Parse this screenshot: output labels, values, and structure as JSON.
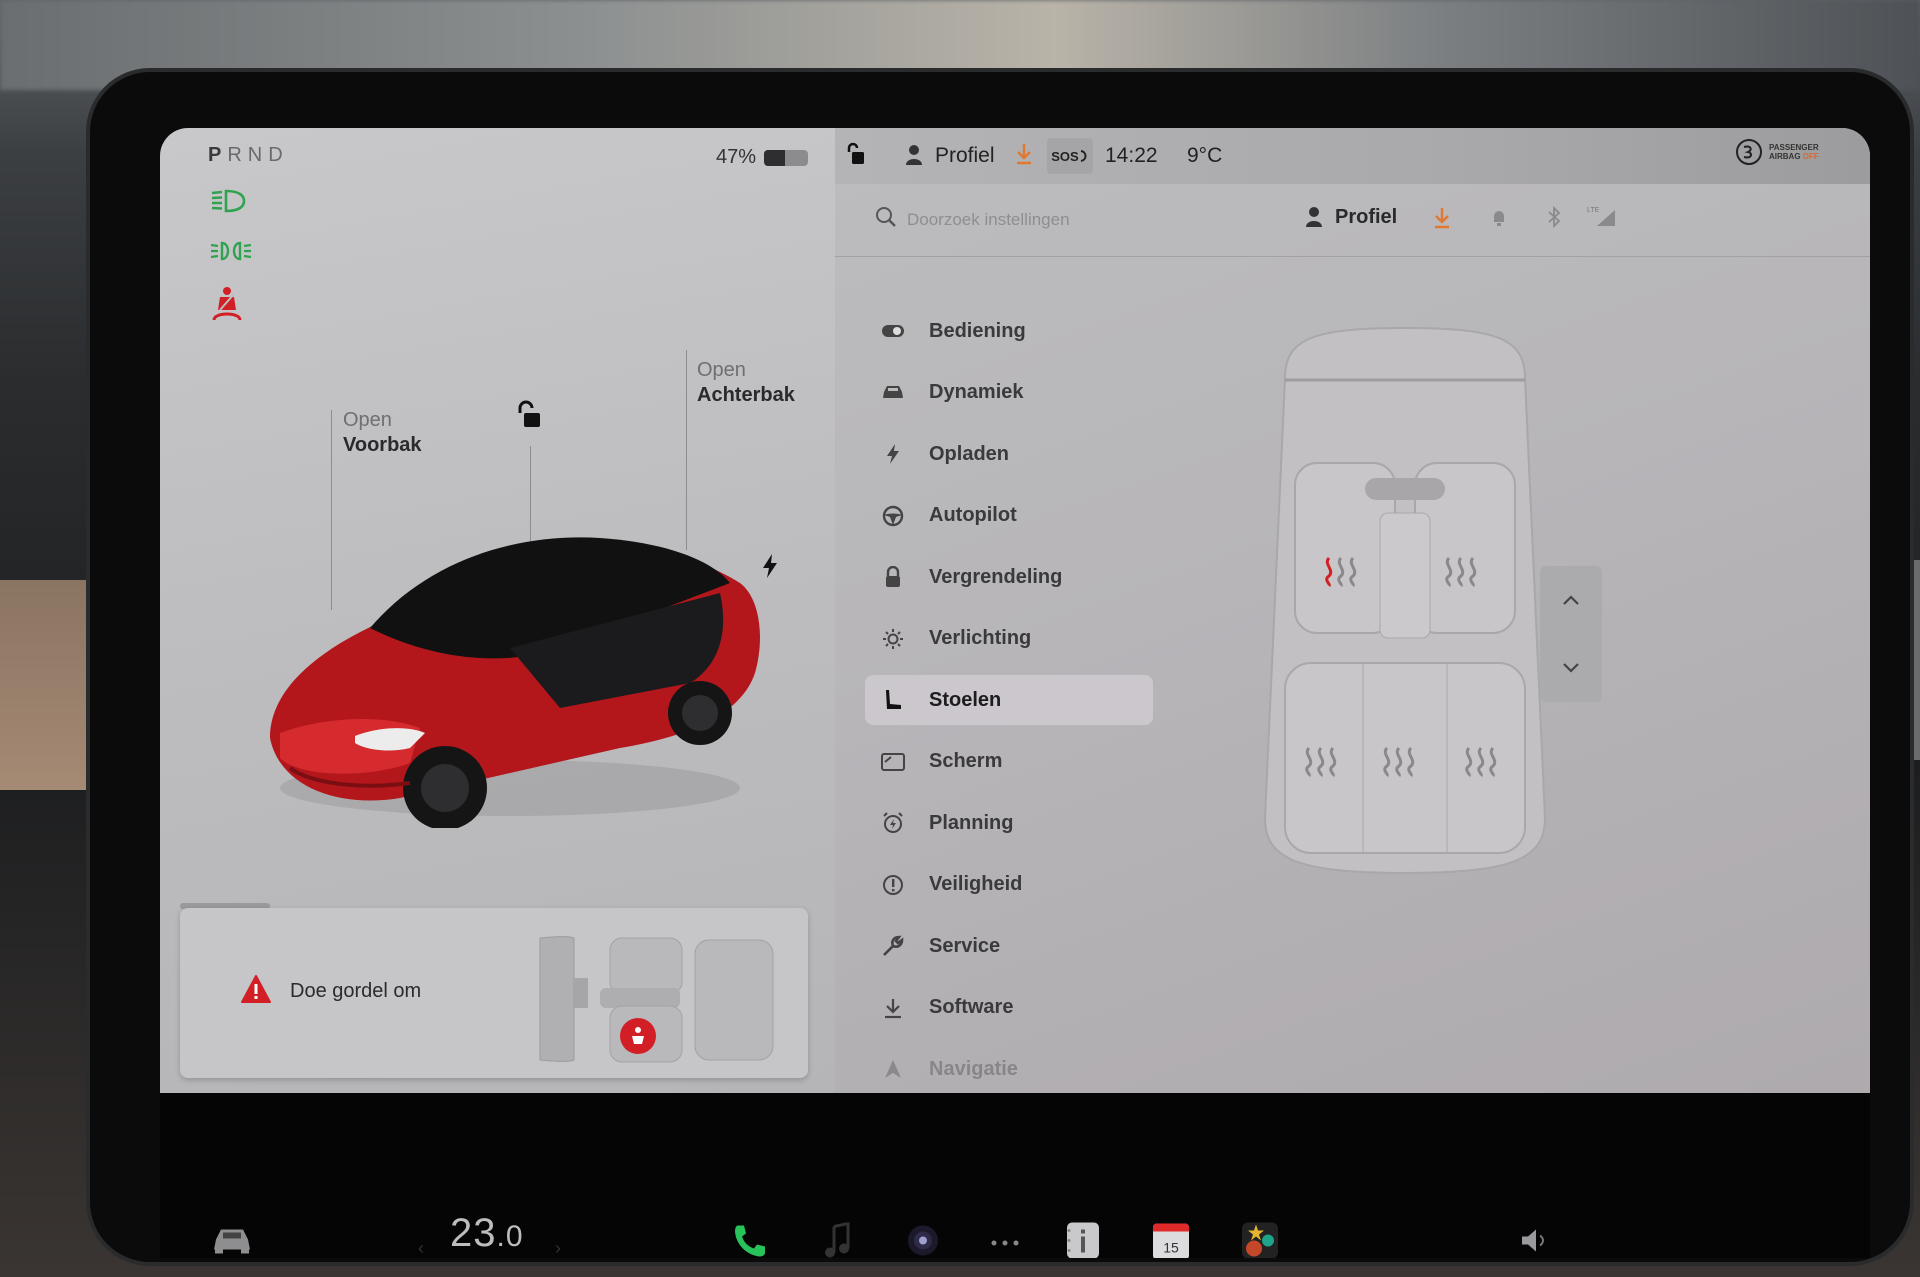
{
  "left_panel": {
    "gear": {
      "letters": [
        "P",
        "R",
        "N",
        "D"
      ],
      "active": "P"
    },
    "battery": {
      "percent_label": "47%",
      "level": 0.47
    },
    "frunk": {
      "action": "Open",
      "label": "Voorbak"
    },
    "trunk": {
      "action": "Open",
      "label": "Achterbak"
    },
    "indicators": [
      "low-beam-headlight",
      "parking-lights",
      "seatbelt-warning"
    ],
    "alert": {
      "message": "Doe gordel om"
    }
  },
  "status_bar": {
    "profile_label": "Profiel",
    "sos_label": "SOS",
    "time": "14:22",
    "outside_temp": "9°C",
    "airbag": {
      "line1": "PASSENGER",
      "line2": "AIRBAG",
      "state": "OFF"
    }
  },
  "settings_header": {
    "search_placeholder": "Doorzoek instellingen",
    "profile_label": "Profiel"
  },
  "menu": {
    "items": [
      {
        "label": "Bediening",
        "icon": "toggle-icon"
      },
      {
        "label": "Dynamiek",
        "icon": "car-icon"
      },
      {
        "label": "Opladen",
        "icon": "bolt-icon"
      },
      {
        "label": "Autopilot",
        "icon": "steering-wheel-icon"
      },
      {
        "label": "Vergrendeling",
        "icon": "lock-icon"
      },
      {
        "label": "Verlichting",
        "icon": "sun-icon"
      },
      {
        "label": "Stoelen",
        "icon": "seat-icon"
      },
      {
        "label": "Scherm",
        "icon": "display-icon"
      },
      {
        "label": "Planning",
        "icon": "alarm-clock-icon"
      },
      {
        "label": "Veiligheid",
        "icon": "alert-circle-icon"
      },
      {
        "label": "Service",
        "icon": "wrench-icon"
      },
      {
        "label": "Software",
        "icon": "download-icon"
      },
      {
        "label": "Navigatie",
        "icon": "navigation-icon"
      }
    ],
    "active": "Stoelen"
  },
  "seat_heaters": {
    "driver": 1,
    "passenger": 0,
    "rear_left": 0,
    "rear_center": 0,
    "rear_right": 0,
    "max_level": 3
  },
  "dock": {
    "cabin_temp_int": "23",
    "cabin_temp_dec": ".0",
    "apps": [
      "phone",
      "music",
      "camera",
      "more",
      "manual",
      "calendar",
      "toybox"
    ],
    "calendar_day": "15"
  },
  "colors": {
    "accent_orange": "#e2772f",
    "indicator_green": "#2fa34f",
    "warning_red": "#d21f26",
    "phone_green": "#27c25a"
  }
}
